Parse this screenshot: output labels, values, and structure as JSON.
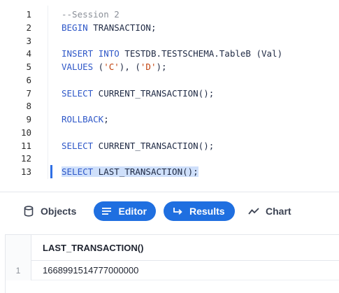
{
  "editor": {
    "lines": [
      {
        "num": "1",
        "tokens": [
          {
            "t": "--Session 2",
            "c": "comment"
          }
        ]
      },
      {
        "num": "2",
        "tokens": [
          {
            "t": "BEGIN",
            "c": "kw"
          },
          {
            "t": " TRANSACTION;",
            "c": "plain"
          }
        ]
      },
      {
        "num": "3",
        "tokens": []
      },
      {
        "num": "4",
        "tokens": [
          {
            "t": "INSERT",
            "c": "kw"
          },
          {
            "t": " ",
            "c": "plain"
          },
          {
            "t": "INTO",
            "c": "kw"
          },
          {
            "t": " TESTDB.TESTSCHEMA.TableB (Val)",
            "c": "plain"
          }
        ]
      },
      {
        "num": "5",
        "tokens": [
          {
            "t": "VALUES",
            "c": "kw"
          },
          {
            "t": " (",
            "c": "plain"
          },
          {
            "t": "'C'",
            "c": "str"
          },
          {
            "t": "), (",
            "c": "plain"
          },
          {
            "t": "'D'",
            "c": "str"
          },
          {
            "t": ");",
            "c": "plain"
          }
        ]
      },
      {
        "num": "6",
        "tokens": []
      },
      {
        "num": "7",
        "tokens": [
          {
            "t": "SELECT",
            "c": "kw"
          },
          {
            "t": " CURRENT_TRANSACTION();",
            "c": "plain"
          }
        ]
      },
      {
        "num": "8",
        "tokens": []
      },
      {
        "num": "9",
        "tokens": [
          {
            "t": "ROLLBACK",
            "c": "kw"
          },
          {
            "t": ";",
            "c": "plain"
          }
        ]
      },
      {
        "num": "10",
        "tokens": []
      },
      {
        "num": "11",
        "tokens": [
          {
            "t": "SELECT",
            "c": "kw"
          },
          {
            "t": " CURRENT_TRANSACTION();",
            "c": "plain"
          }
        ]
      },
      {
        "num": "12",
        "tokens": []
      },
      {
        "num": "13",
        "tokens": [
          {
            "t": "SELECT",
            "c": "kw"
          },
          {
            "t": " LAST_TRANSACTION();",
            "c": "plain"
          }
        ],
        "selected": true
      }
    ]
  },
  "toolbar": {
    "objects_label": "Objects",
    "editor_label": "Editor",
    "results_label": "Results",
    "chart_label": "Chart"
  },
  "results": {
    "columns": [
      "LAST_TRANSACTION()"
    ],
    "rows": [
      {
        "num": "1",
        "cells": [
          "1668991514777000000"
        ]
      }
    ]
  },
  "colors": {
    "accent": "#1f6fe0",
    "keyword": "#2f58c8",
    "string": "#c2410c",
    "comment": "#8a8f98",
    "selection": "#cfe0fb"
  }
}
